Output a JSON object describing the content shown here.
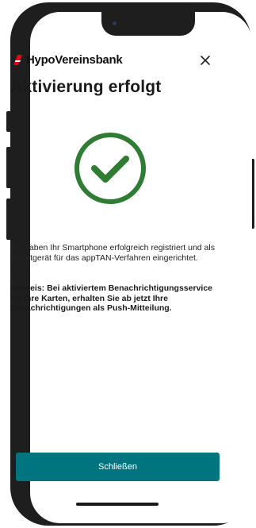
{
  "header": {
    "logo_text": "HypoVereinsbank",
    "logo_icon": "hvb-logo-icon",
    "close_icon": "close-icon",
    "brand_color": "#e2001a"
  },
  "main": {
    "title": "Aktivierung erfolgt",
    "status_icon": "checkmark-circle-icon",
    "status_color": "#2e7d32",
    "description": "Sie haben Ihr Smartphone erfolgreich registriert und als Hauptgerät für das appTAN-Verfahren eingerichtet.",
    "hint": "Hinweis: Bei aktiviertem Benachrichtigungsservice für Ihre Karten, erhalten Sie ab jetzt Ihre Benachrichtigungen als Push-Mitteilung."
  },
  "footer": {
    "close_button_label": "Schließen",
    "button_color": "#007580"
  }
}
